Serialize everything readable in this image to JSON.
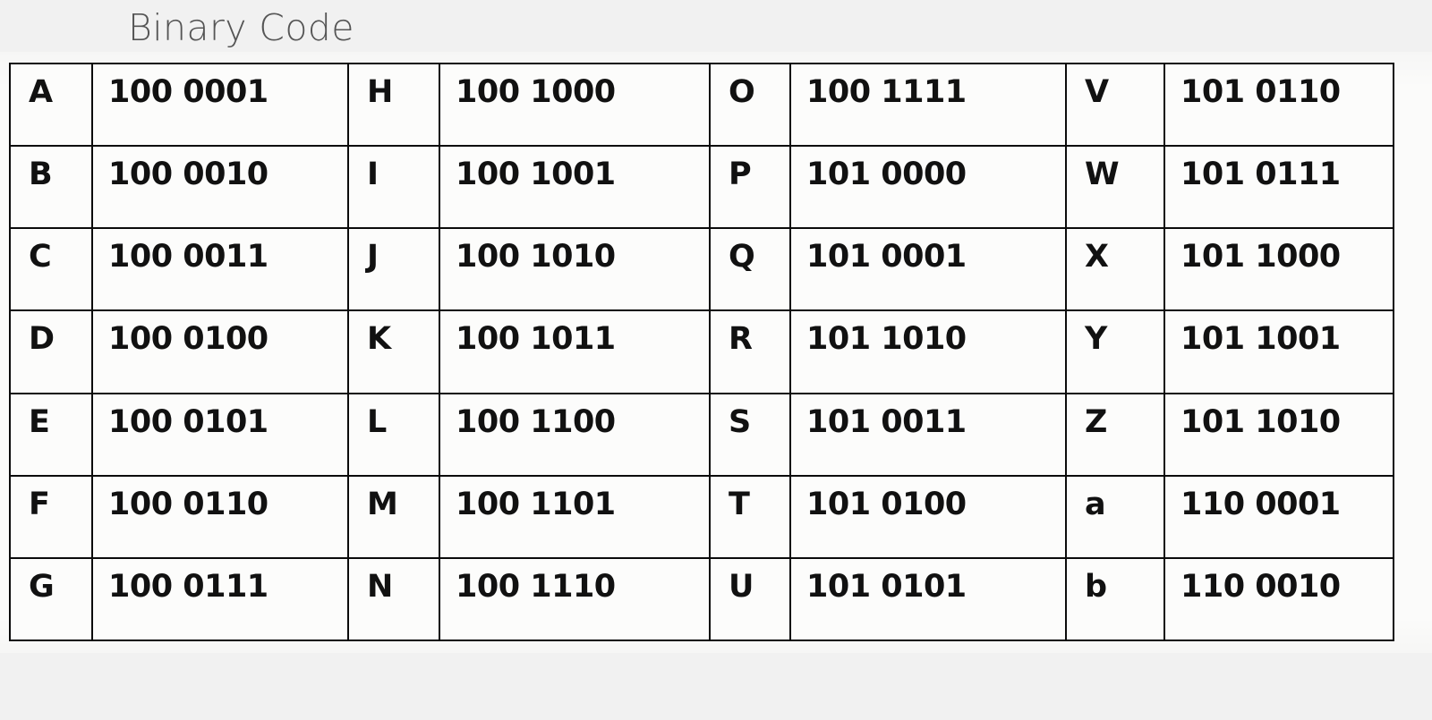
{
  "title": "Binary Code",
  "colors": {
    "page_background": "#f1f1f1",
    "scan_background": "#fbfbfa",
    "title_text": "#555555",
    "table_border": "#0b0b0b",
    "cell_text": "#111111"
  },
  "table": {
    "rows": [
      {
        "letter1": "A",
        "code1": "100 0001",
        "letter2": "H",
        "code2": "100 1000",
        "letter3": "O",
        "code3": "100 1111",
        "letter4": "V",
        "code4": "101 0110"
      },
      {
        "letter1": "B",
        "code1": "100 0010",
        "letter2": "I",
        "code2": "100 1001",
        "letter3": "P",
        "code3": "101 0000",
        "letter4": "W",
        "code4": "101 0111"
      },
      {
        "letter1": "C",
        "code1": "100 0011",
        "letter2": "J",
        "code2": "100 1010",
        "letter3": "Q",
        "code3": "101 0001",
        "letter4": "X",
        "code4": "101 1000"
      },
      {
        "letter1": "D",
        "code1": "100 0100",
        "letter2": "K",
        "code2": "100 1011",
        "letter3": "R",
        "code3": "101 1010",
        "letter4": "Y",
        "code4": "101 1001"
      },
      {
        "letter1": "E",
        "code1": "100 0101",
        "letter2": "L",
        "code2": "100 1100",
        "letter3": "S",
        "code3": "101 0011",
        "letter4": "Z",
        "code4": "101 1010"
      },
      {
        "letter1": "F",
        "code1": "100 0110",
        "letter2": "M",
        "code2": "100 1101",
        "letter3": "T",
        "code3": "101 0100",
        "letter4": "a",
        "code4": "110 0001"
      },
      {
        "letter1": "G",
        "code1": "100 0111",
        "letter2": "N",
        "code2": "100 1110",
        "letter3": "U",
        "code3": "101 0101",
        "letter4": "b",
        "code4": "110 0010"
      }
    ]
  }
}
